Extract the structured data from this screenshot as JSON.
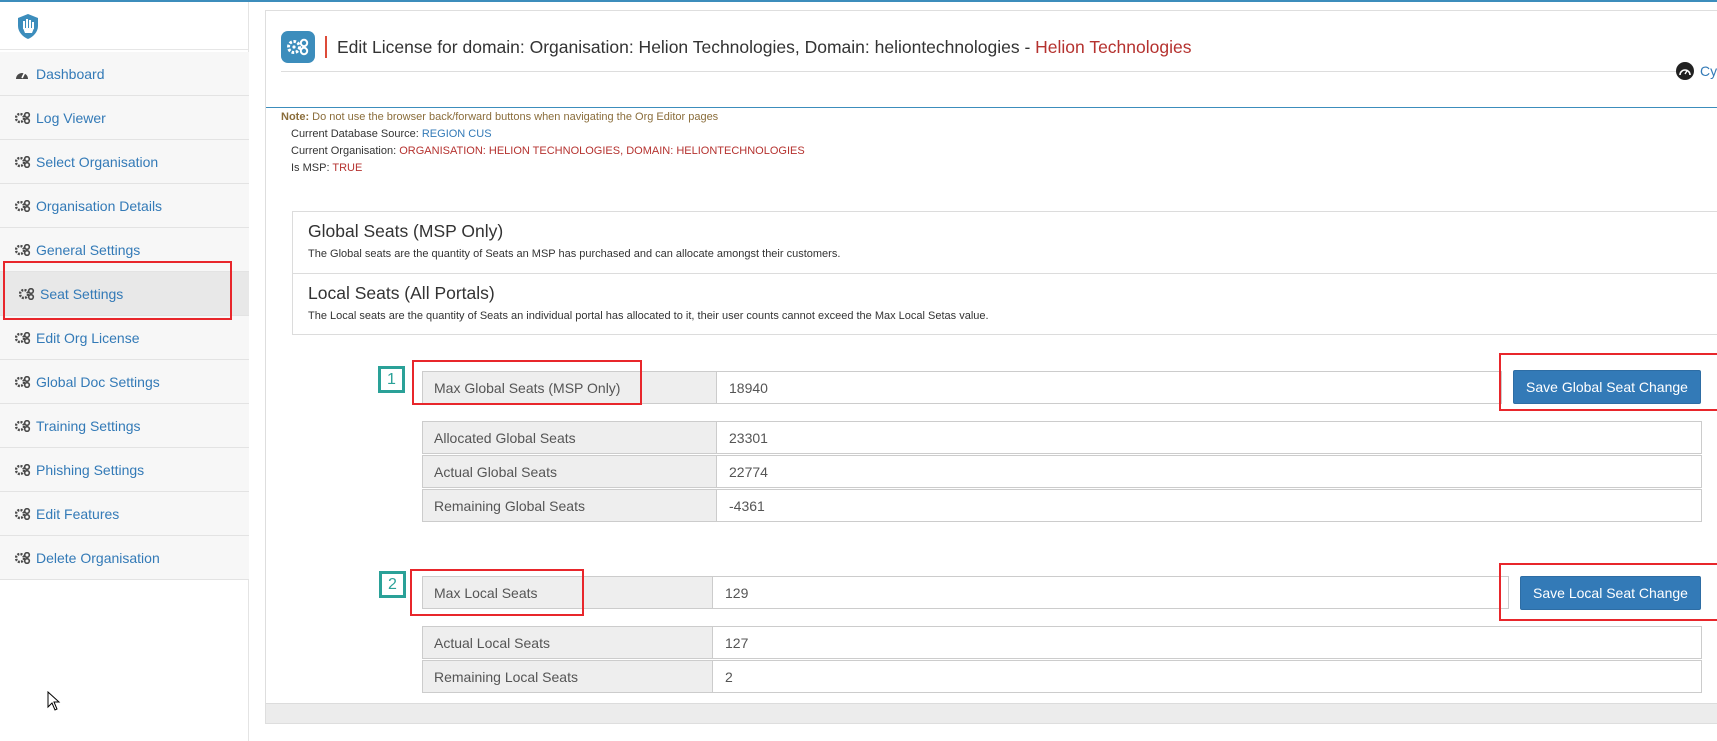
{
  "sidebar": {
    "items": [
      {
        "label": "Dashboard",
        "icon": "dashboard-icon"
      },
      {
        "label": "Log Viewer",
        "icon": "gears-icon"
      },
      {
        "label": "Select Organisation",
        "icon": "gears-icon"
      },
      {
        "label": "Organisation Details",
        "icon": "gears-icon"
      },
      {
        "label": "General Settings",
        "icon": "gears-icon"
      },
      {
        "label": "Seat Settings",
        "icon": "gears-icon",
        "active": true
      },
      {
        "label": "Edit Org License",
        "icon": "gears-icon"
      },
      {
        "label": "Global Doc Settings",
        "icon": "gears-icon"
      },
      {
        "label": "Training Settings",
        "icon": "gears-icon"
      },
      {
        "label": "Phishing Settings",
        "icon": "gears-icon"
      },
      {
        "label": "Edit Features",
        "icon": "gears-icon"
      },
      {
        "label": "Delete Organisation",
        "icon": "gears-icon"
      }
    ]
  },
  "header": {
    "title": "Edit License for domain: Organisation: Helion Technologies, Domain: heliontechnologies",
    "separator": " - ",
    "org_name": "Helion Technologies",
    "right_link": "Cy"
  },
  "info": {
    "note_label": "Note:",
    "note_text": "Do not use the browser back/forward buttons when navigating the Org Editor pages",
    "db_label": "Current Database Source:",
    "db_value": "REGION CUS",
    "org_label": "Current Organisation:",
    "org_value": "ORGANISATION: HELION TECHNOLOGIES, DOMAIN: HELIONTECHNOLOGIES",
    "msp_label": "Is MSP:",
    "msp_value": "TRUE"
  },
  "seat_info": {
    "global_title": "Global Seats (MSP Only)",
    "global_desc": "The Global seats are the quantity of Seats an MSP has purchased and can allocate amongst their customers.",
    "local_title": "Local Seats (All Portals)",
    "local_desc": "The Local seats are the quantity of Seats an individual portal has allocated to it, their user counts cannot exceed the Max Local Setas value."
  },
  "global_form": {
    "step": "1",
    "max_label": "Max Global Seats (MSP Only)",
    "max_value": "18940",
    "save_button": "Save Global Seat Change",
    "allocated_label": "Allocated Global Seats",
    "allocated_value": "23301",
    "actual_label": "Actual Global Seats",
    "actual_value": "22774",
    "remaining_label": "Remaining Global Seats",
    "remaining_value": "-4361"
  },
  "local_form": {
    "step": "2",
    "max_label": "Max Local Seats",
    "max_value": "129",
    "save_button": "Save Local Seat Change",
    "actual_label": "Actual Local Seats",
    "actual_value": "127",
    "remaining_label": "Remaining Local Seats",
    "remaining_value": "2"
  },
  "colors": {
    "accent": "#337ab7",
    "highlight_border": "#e8262b",
    "step_badge": "#2aa198",
    "org_red": "#b5322f"
  }
}
